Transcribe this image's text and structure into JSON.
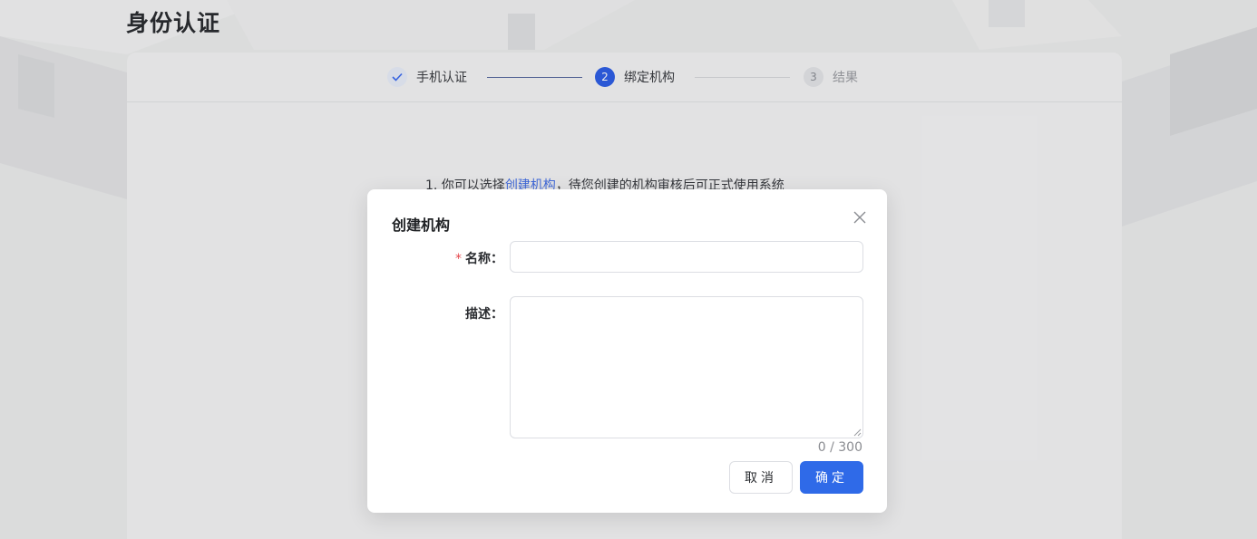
{
  "page": {
    "title": "身份认证"
  },
  "steps": [
    {
      "index": "1",
      "label": "手机认证",
      "status": "done"
    },
    {
      "index": "2",
      "label": "绑定机构",
      "status": "active"
    },
    {
      "index": "3",
      "label": "结果",
      "status": "wait"
    }
  ],
  "card": {
    "line1_prefix": "1. 你可以选择",
    "line1_link": "创建机构",
    "line1_suffix": "，待您创建的机构审核后可正式使用系统"
  },
  "modal": {
    "title": "创建机构",
    "name_label": "名称：",
    "name_required_mark": "*",
    "name_value": "",
    "desc_label": "描述：",
    "desc_value": "",
    "char_count": "0 / 300",
    "cancel_label": "取消",
    "ok_label": "确定"
  },
  "icons": {
    "step_done": "check-icon",
    "close": "close-icon",
    "textarea_resize": "resize-grip-icon"
  },
  "colors": {
    "primary": "#2f6ae8",
    "step_active": "#2f5fe6",
    "link": "#4470e8",
    "required": "#e5484d"
  }
}
